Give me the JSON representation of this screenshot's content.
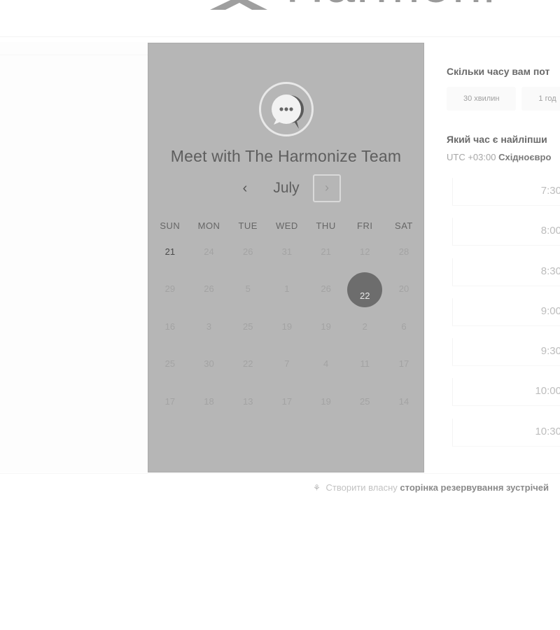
{
  "header": {
    "logo_text": "Harmoni"
  },
  "calendar": {
    "title": "Meet with The Harmonize Team",
    "month": "July",
    "prev_label": "‹",
    "next_label": "›",
    "weekdays": [
      "SUN",
      "MON",
      "TUE",
      "WED",
      "THU",
      "FRI",
      "SAT"
    ],
    "weeks": [
      [
        "21",
        "24",
        "26",
        "31",
        "21",
        "12",
        "28"
      ],
      [
        "29",
        "26",
        "5",
        "1",
        "26",
        "22",
        "20"
      ],
      [
        "16",
        "3",
        "25",
        "19",
        "19",
        "2",
        "6"
      ],
      [
        "25",
        "30",
        "22",
        "7",
        "4",
        "11",
        "17"
      ],
      [
        "17",
        "18",
        "13",
        "17",
        "19",
        "25",
        "14"
      ]
    ],
    "selected_day": "22"
  },
  "booking": {
    "duration_question": "Скільки часу вам пот",
    "durations": [
      "30 хвилин",
      "1 год"
    ],
    "time_question": "Який час є найліпши",
    "timezone_offset": "UTC +03:00",
    "timezone_name": "Східноєвро",
    "slots": [
      "7:30",
      "8:00",
      "8:30",
      "9:00",
      "9:30",
      "10:00",
      "10:30"
    ]
  },
  "footer": {
    "prefix": "Створити власну",
    "link": "сторінка резервування зустрічей"
  },
  "colors": {
    "panel": "#b6b6b6",
    "selected_day": "#6d6d6d"
  }
}
